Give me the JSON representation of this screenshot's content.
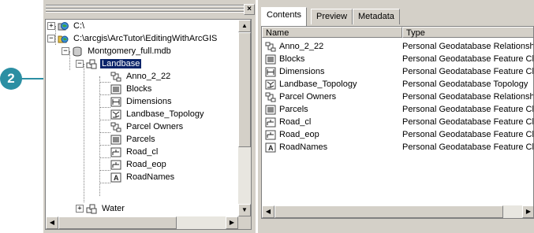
{
  "callout": {
    "number": "2"
  },
  "tree": {
    "close_glyph": "×",
    "nodes": [
      {
        "label": "C:\\",
        "icon": "drive-globe-icon",
        "expander": "+"
      },
      {
        "label": "C:\\arcgis\\ArcTutor\\EditingWithArcGIS",
        "icon": "folder-globe-icon",
        "expander": "−"
      },
      {
        "label": "Montgomery_full.mdb",
        "icon": "database-icon",
        "expander": "−"
      },
      {
        "label": "Landbase",
        "icon": "feature-dataset-icon",
        "expander": "−",
        "selected": true
      },
      {
        "label": "Anno_2_22",
        "icon": "relationship-class-icon"
      },
      {
        "label": "Blocks",
        "icon": "polygon-feature-class-icon"
      },
      {
        "label": "Dimensions",
        "icon": "dimension-feature-class-icon"
      },
      {
        "label": "Landbase_Topology",
        "icon": "topology-icon"
      },
      {
        "label": "Parcel Owners",
        "icon": "relationship-class-icon"
      },
      {
        "label": "Parcels",
        "icon": "polygon-feature-class-icon"
      },
      {
        "label": "Road_cl",
        "icon": "line-feature-class-icon"
      },
      {
        "label": "Road_eop",
        "icon": "line-feature-class-icon"
      },
      {
        "label": "RoadNames",
        "icon": "annotation-feature-class-icon"
      },
      {
        "label": "Water",
        "icon": "feature-dataset-icon",
        "expander": "+"
      }
    ]
  },
  "tabs": [
    {
      "label": "Contents",
      "active": true
    },
    {
      "label": "Preview",
      "active": false
    },
    {
      "label": "Metadata",
      "active": false
    }
  ],
  "columns": {
    "name": "Name",
    "type": "Type"
  },
  "items": [
    {
      "name": "Anno_2_22",
      "type": "Personal Geodatabase Relationship Class",
      "icon": "relationship-class-icon"
    },
    {
      "name": "Blocks",
      "type": "Personal Geodatabase Feature Class",
      "icon": "polygon-feature-class-icon"
    },
    {
      "name": "Dimensions",
      "type": "Personal Geodatabase Feature Class",
      "icon": "dimension-feature-class-icon"
    },
    {
      "name": "Landbase_Topology",
      "type": "Personal Geodatabase Topology",
      "icon": "topology-icon"
    },
    {
      "name": "Parcel Owners",
      "type": "Personal Geodatabase Relationship Class",
      "icon": "relationship-class-icon"
    },
    {
      "name": "Parcels",
      "type": "Personal Geodatabase Feature Class",
      "icon": "polygon-feature-class-icon"
    },
    {
      "name": "Road_cl",
      "type": "Personal Geodatabase Feature Class",
      "icon": "line-feature-class-icon"
    },
    {
      "name": "Road_eop",
      "type": "Personal Geodatabase Feature Class",
      "icon": "line-feature-class-icon"
    },
    {
      "name": "RoadNames",
      "type": "Personal Geodatabase Feature Class",
      "icon": "annotation-feature-class-icon"
    }
  ],
  "colors": {
    "selection": "#0a246a",
    "callout": "#2c8fa3",
    "panel": "#d4d0c8"
  }
}
